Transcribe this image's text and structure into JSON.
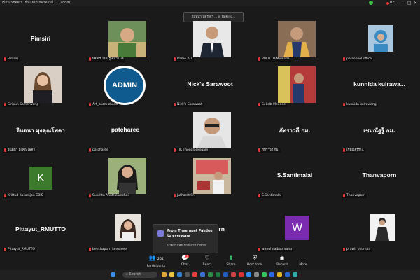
{
  "window": {
    "title": "เรียน Sheets เข้มแผนนักคาจารย์ ... (Zoom)",
    "rec_label": "REC"
  },
  "speaking": "กิมหนา นคร.ดา ... is talking...",
  "tiles": [
    {
      "name": "Pimsiri",
      "label": "Pimsiri"
    },
    {
      "name": "",
      "label": "ผศ.ดร.ใจจะรู้ ตมาแนส"
    },
    {
      "name": "",
      "label": "Rame 2/1"
    },
    {
      "name": "",
      "label": "RMUTTO/Midsada"
    },
    {
      "name": "",
      "label": "personnel office"
    },
    {
      "name": "",
      "label": "Siripun Samerwong"
    },
    {
      "name": "ADMIN",
      "label": "Art_zoom chanil"
    },
    {
      "name": "Nick's Sarawoot",
      "label": "Nick's Sarawoot"
    },
    {
      "name": "",
      "label": "Sekslb Meedee"
    },
    {
      "name": "kunnida  kulrawa...",
      "label": "kunnida kulrawang"
    },
    {
      "name": "จินตนา มุงคุณโพคา",
      "label": "จินตนา มงคุณโพคา"
    },
    {
      "name": "patcharee",
      "label": "patcharee"
    },
    {
      "name": "",
      "label": "TIK Thonglaeksgam"
    },
    {
      "name": "ภัทราวดี กม.",
      "label": "ภัทราวดี กม."
    },
    {
      "name": "เชมณัฐรู้ กม.",
      "label": "เชมณัฐรู้ร่าง."
    },
    {
      "name": "K",
      "label": "Krittud Kasomjon CBIS"
    },
    {
      "name": "",
      "label": "Sukritta Anutrakunchai"
    },
    {
      "name": "",
      "label": "Jutharat Sr."
    },
    {
      "name": "S.Santimalai",
      "label": "S.Santimalai"
    },
    {
      "name": "Thanvaporn",
      "label": "Thanvaporn"
    },
    {
      "name": "Pittayut_RMUTTO",
      "label": "Pittayut_RMUTTO"
    },
    {
      "name": "",
      "label": "benchaporn kemanee"
    },
    {
      "name": "oorn",
      "label": ""
    },
    {
      "name": "W",
      "label": "wimol naiboonrana"
    },
    {
      "name": "",
      "label": "prawit phumpa"
    }
  ],
  "toast": {
    "title": "From Theerapat Pakdee to everyone",
    "message": "นายธีรภัทร ภักดี สำนักวิชาก"
  },
  "toolbar": {
    "participants_label": "Participants",
    "participants_count": "264",
    "chat_label": "Chat",
    "chat_badge": "2",
    "react_label": "React",
    "share_label": "Share",
    "host_tools_label": "Host tools",
    "record_label": "Record",
    "more_label": "More"
  },
  "taskbar": {
    "search_placeholder": "Search"
  },
  "colors": {
    "background": "#1a1a1a",
    "admin_blue": "#0f5a8f",
    "k_green": "#3c7a2c",
    "w_purple": "#7a2bb0",
    "mic_red": "#e23b3b"
  }
}
